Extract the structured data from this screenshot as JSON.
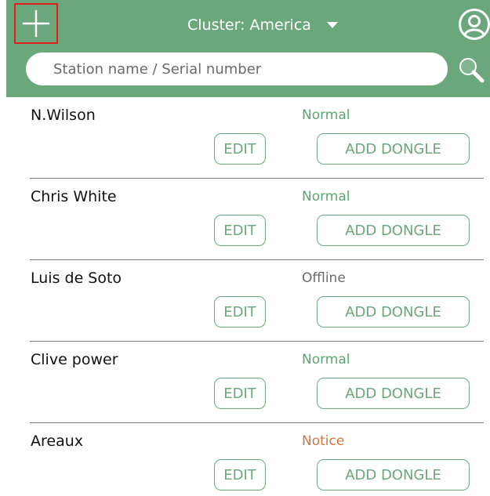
{
  "colors": {
    "header_bg": "#6aa87c",
    "accent": "#6aa87c",
    "highlight_border": "#e02020",
    "status_normal": "#5aa672",
    "status_offline": "#6a6a6a",
    "status_notice": "#d0753f"
  },
  "header": {
    "add_icon": "plus-icon",
    "cluster_label": "Cluster: America",
    "cluster_icon": "caret-down-icon",
    "user_icon": "user-circle-icon"
  },
  "search": {
    "placeholder": "Station name / Serial number",
    "value": "",
    "icon": "magnifier-icon"
  },
  "stations": [
    {
      "name": "N.Wilson",
      "status": "Normal",
      "status_type": "normal",
      "edit_label": "EDIT",
      "dongle_label": "ADD DONGLE"
    },
    {
      "name": "Chris White",
      "status": "Normal",
      "status_type": "normal",
      "edit_label": "EDIT",
      "dongle_label": "ADD DONGLE"
    },
    {
      "name": "Luis de Soto",
      "status": "Offline",
      "status_type": "offline",
      "edit_label": "EDIT",
      "dongle_label": "ADD DONGLE"
    },
    {
      "name": "Clive power",
      "status": "Normal",
      "status_type": "normal",
      "edit_label": "EDIT",
      "dongle_label": "ADD DONGLE"
    },
    {
      "name": "Areaux",
      "status": "Notice",
      "status_type": "notice",
      "edit_label": "EDIT",
      "dongle_label": "ADD DONGLE"
    }
  ]
}
